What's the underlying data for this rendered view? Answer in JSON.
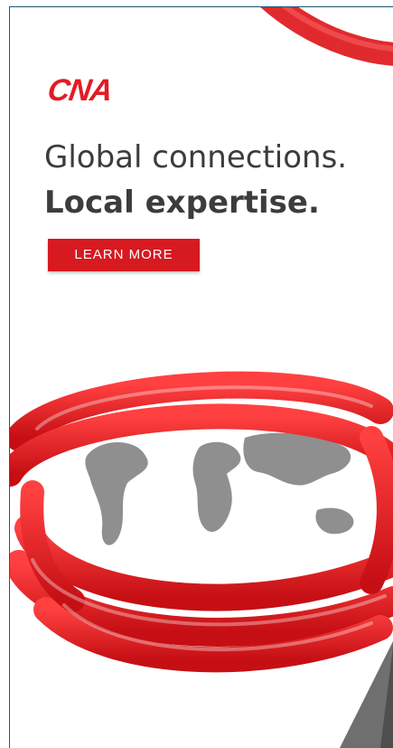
{
  "brand": {
    "logo_text": "CNA",
    "accent_color": "#e31b23"
  },
  "headline": {
    "line1": "Global connections.",
    "line2": "Local expertise."
  },
  "cta": {
    "label": "LEARN MORE",
    "color": "#d71920"
  },
  "hero": {
    "image": "red-cable-coiled-around-world-map",
    "icon": "world-map-icon"
  },
  "theme": {
    "frame_border": "#1d5a73",
    "text_color": "#3c3c3c"
  }
}
